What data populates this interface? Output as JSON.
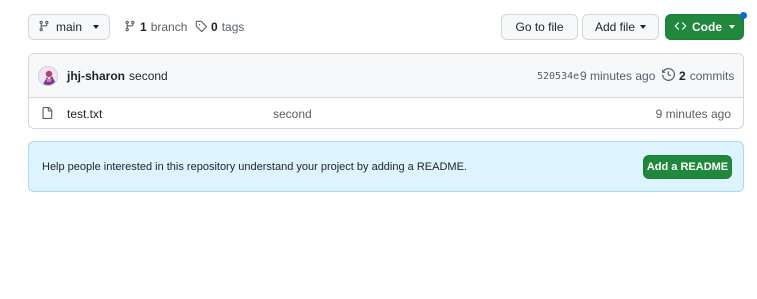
{
  "toolbar": {
    "branch_name": "main",
    "branches_count": "1",
    "branches_label": "branch",
    "tags_count": "0",
    "tags_label": "tags",
    "go_to_file_label": "Go to file",
    "add_file_label": "Add file",
    "code_label": "Code"
  },
  "latest_commit": {
    "author": "jhj-sharon",
    "message": "second",
    "sha": "520534e",
    "time": "9 minutes ago",
    "commits_count": "2",
    "commits_label": "commits"
  },
  "files": [
    {
      "name": "test.txt",
      "message": "second",
      "time": "9 minutes ago"
    }
  ],
  "readme_banner": {
    "text": "Help people interested in this repository understand your project by adding a README.",
    "button_label": "Add a README"
  },
  "colors": {
    "primary_green": "#1f883d",
    "banner_blue": "#ddf4ff",
    "notification_dot": "#0969da"
  },
  "icons": [
    "git-branch-icon",
    "tag-icon",
    "code-icon",
    "history-icon",
    "file-icon",
    "caret-down-icon"
  ]
}
